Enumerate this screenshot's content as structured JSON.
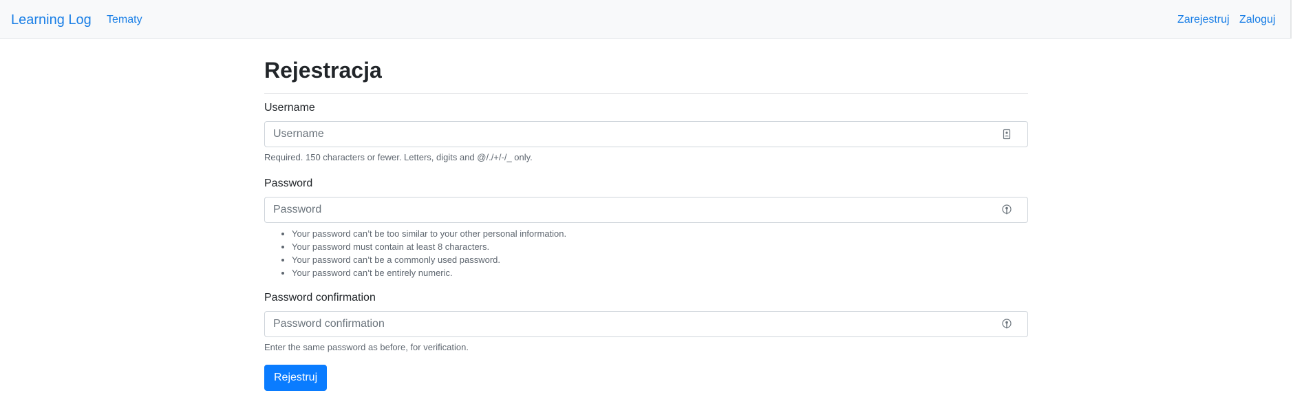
{
  "navbar": {
    "brand": "Learning Log",
    "topics_link": "Tematy",
    "register_link": "Zarejestruj",
    "login_link": "Zaloguj"
  },
  "page": {
    "title": "Rejestracja"
  },
  "form": {
    "username": {
      "label": "Username",
      "placeholder": "Username",
      "value": "",
      "help": "Required. 150 characters or fewer. Letters, digits and @/./+/-/_ only.",
      "icon": "contact-card-icon"
    },
    "password": {
      "label": "Password",
      "placeholder": "Password",
      "value": "",
      "help_items": [
        "Your password can’t be too similar to your other personal information.",
        "Your password must contain at least 8 characters.",
        "Your password can’t be a commonly used password.",
        "Your password can’t be entirely numeric."
      ],
      "icon": "key-icon"
    },
    "password_confirmation": {
      "label": "Password confirmation",
      "placeholder": "Password confirmation",
      "value": "",
      "help": "Enter the same password as before, for verification.",
      "icon": "key-icon"
    },
    "submit_label": "Rejestruj"
  },
  "colors": {
    "link": "#1a7fe6",
    "primary_button": "#0a7cff",
    "navbar_bg": "#f8f9fa"
  }
}
